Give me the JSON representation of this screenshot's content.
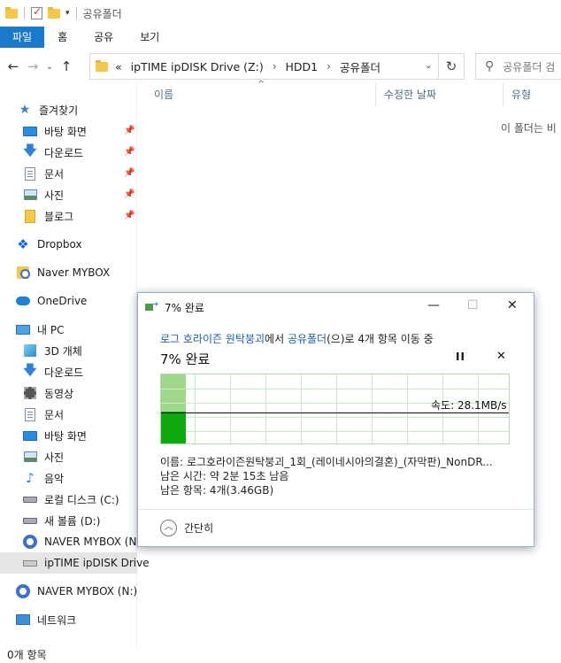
{
  "window": {
    "title": "공유폴더"
  },
  "ribbon": {
    "tabs": [
      "파일",
      "홈",
      "공유",
      "보기"
    ]
  },
  "address": {
    "prefix": "«",
    "crumbs": [
      "ipTIME ipDISK Drive (Z:)",
      "HDD1",
      "공유폴더"
    ],
    "search_placeholder": "공유폴더 검"
  },
  "columns": {
    "name": "이름",
    "modified": "수정한 날짜",
    "type": "유형"
  },
  "empty_text": "이 폴더는 비",
  "nav": {
    "quick_access": "즐겨찾기",
    "quick_items": [
      "바탕 화면",
      "다운로드",
      "문서",
      "사진",
      "블로그"
    ],
    "dropbox": "Dropbox",
    "naver_mybox": "Naver MYBOX",
    "onedrive": "OneDrive",
    "this_pc": "내 PC",
    "pc_items": [
      "3D 개체",
      "다운로드",
      "동영상",
      "문서",
      "바탕 화면",
      "사진",
      "음악",
      "로컬 디스크 (C:)",
      "새 볼륨 (D:)",
      "NAVER MYBOX (N:",
      "ipTIME ipDISK Drive"
    ],
    "naver_drive": "NAVER MYBOX (N:)",
    "network": "네트워크"
  },
  "status": {
    "items": "0개 항목"
  },
  "dialog": {
    "title": "7% 완료",
    "source": "로그 호라이즌 원탁붕괴",
    "middle": "에서 ",
    "dest": "공유폴더",
    "suffix": "(으)로 4개 항목 이동 중",
    "percent_text": "7% 완료",
    "progress_percent": 7,
    "speed": "속도: 28.1MB/s",
    "name_line": "이름: 로그호라이즌원탁붕괴_1회_(레이네시아의결혼)_(자막판)_NonDR...",
    "time_line": "남은 시간: 약 2분 15초 남음",
    "items_line": "남은 항목: 4개(3.46GB)",
    "collapse": "간단히",
    "pause_glyph": "II",
    "close_glyph": "✕"
  }
}
